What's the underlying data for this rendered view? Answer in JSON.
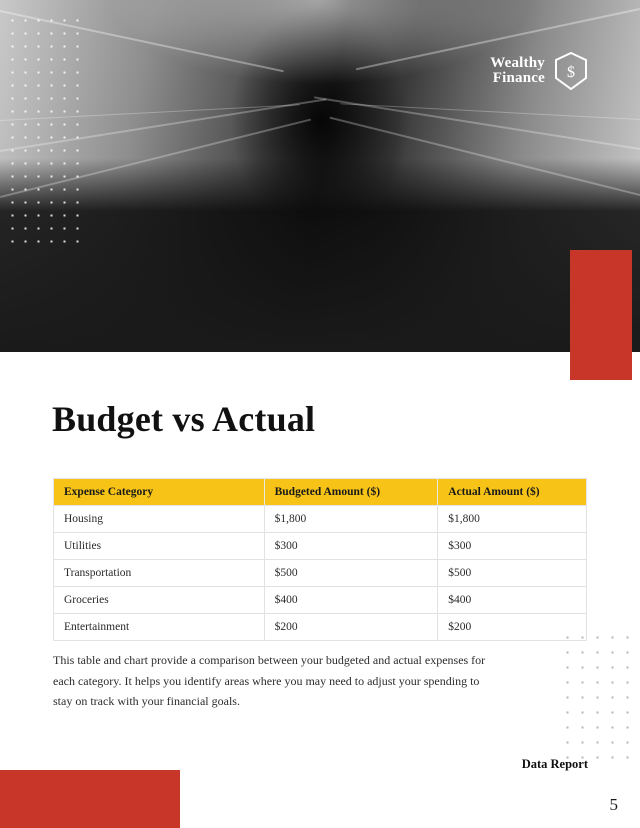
{
  "brand": {
    "line1": "Wealthy",
    "line2": "Finance",
    "mark_icon": "dollar-badge-icon",
    "accent_red": "#c8362a",
    "accent_yellow": "#f6c316"
  },
  "page": {
    "title": "Budget vs Actual",
    "footer_label": "Data Report",
    "page_number": "5"
  },
  "table": {
    "headers": [
      "Expense Category",
      "Budgeted Amount ($)",
      "Actual Amount ($)"
    ],
    "rows": [
      [
        "Housing",
        "$1,800",
        "$1,800"
      ],
      [
        "Utilities",
        "$300",
        "$300"
      ],
      [
        "Transportation",
        "$500",
        "$500"
      ],
      [
        "Groceries",
        "$400",
        "$400"
      ],
      [
        "Entertainment",
        "$200",
        "$200"
      ]
    ]
  },
  "paragraph": "This table and chart provide a comparison between your budgeted and actual expenses for each category. It helps you identify areas where you may need to adjust your spending to stay on track with your financial goals."
}
